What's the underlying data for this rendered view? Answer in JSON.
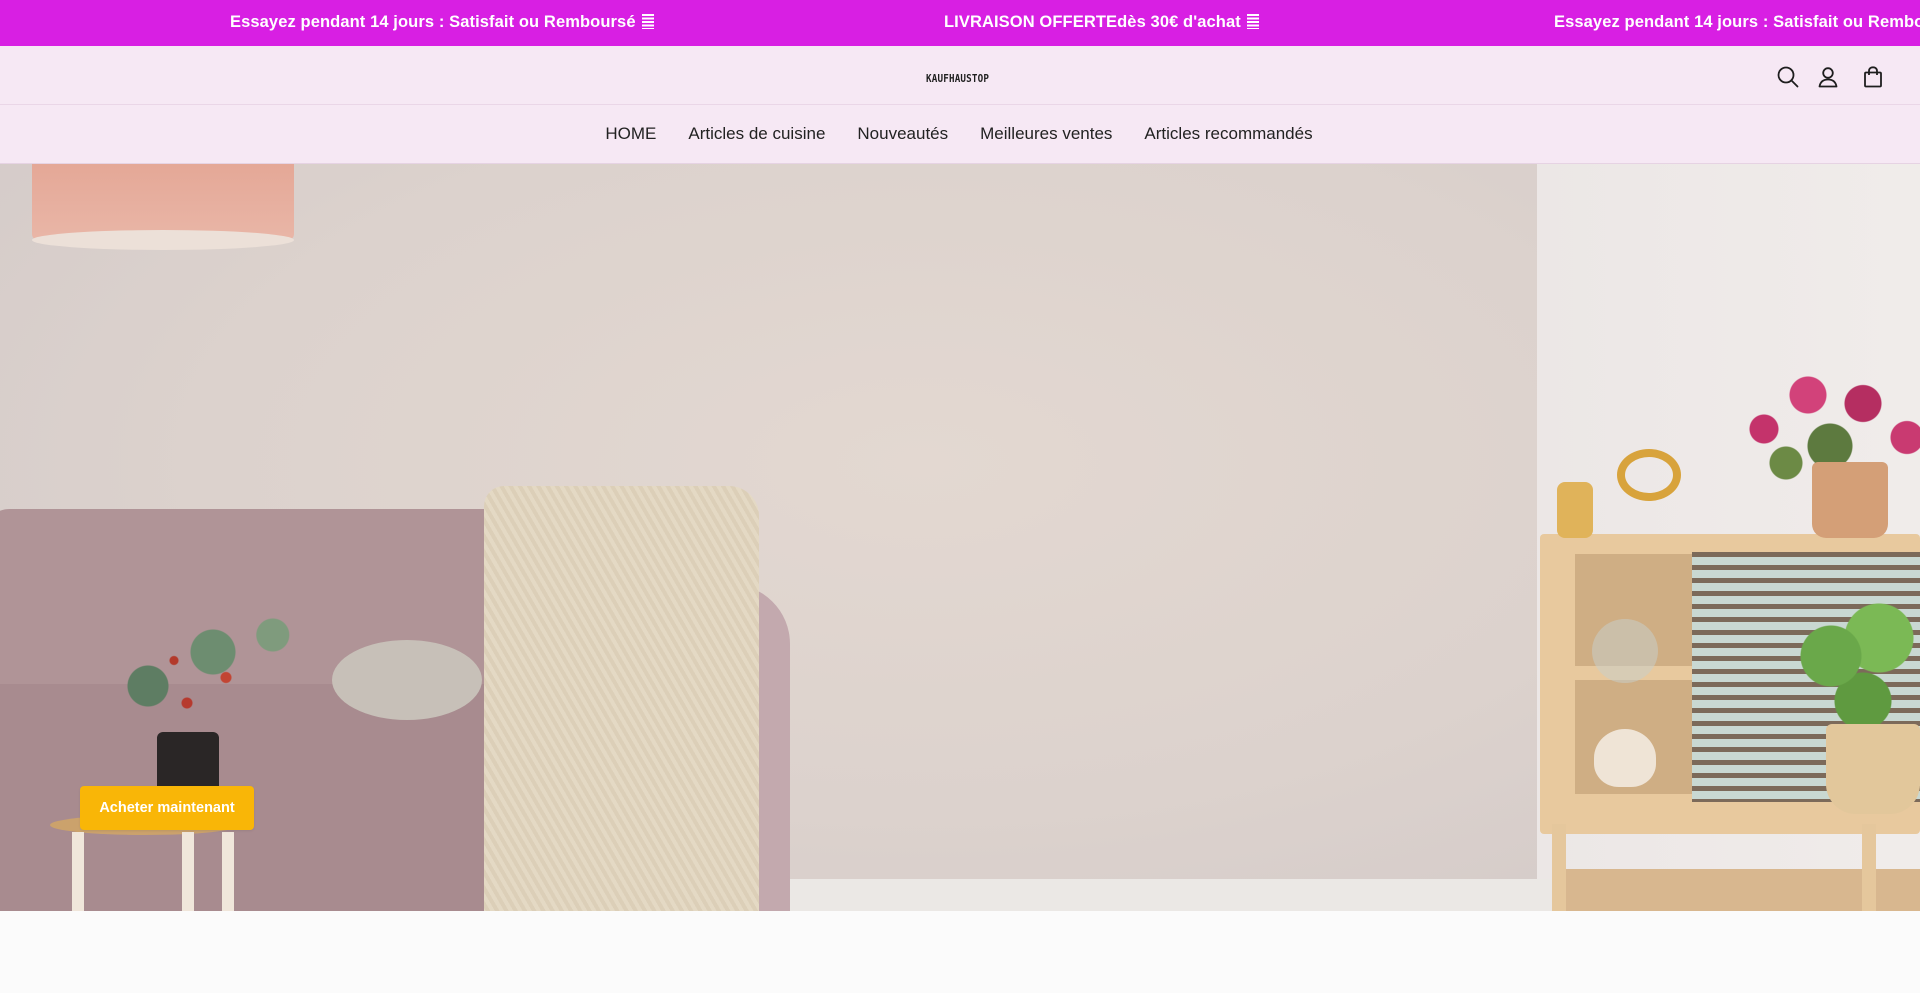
{
  "announcement": {
    "items": [
      "Essayez pendant 14 jours : Satisfait ou Remboursé",
      "LIVRAISON OFFERTEdès 30€ d'achat",
      "Essayez pendant 14 jours : Satisfait ou Rembou"
    ],
    "background": "#d81fe3"
  },
  "header": {
    "logo": "KAUFHAUSTOP",
    "icons": [
      "search-icon",
      "account-icon",
      "cart-icon"
    ]
  },
  "nav": {
    "items": [
      "HOME",
      "Articles de cuisine",
      "Nouveautés",
      "Meilleures ventes",
      "Articles recommandés"
    ]
  },
  "hero": {
    "cta_label": "Acheter maintenant",
    "cta_color": "#f9b607"
  },
  "theme": {
    "header_bg": "#f6e8f4",
    "text": "#222222"
  }
}
